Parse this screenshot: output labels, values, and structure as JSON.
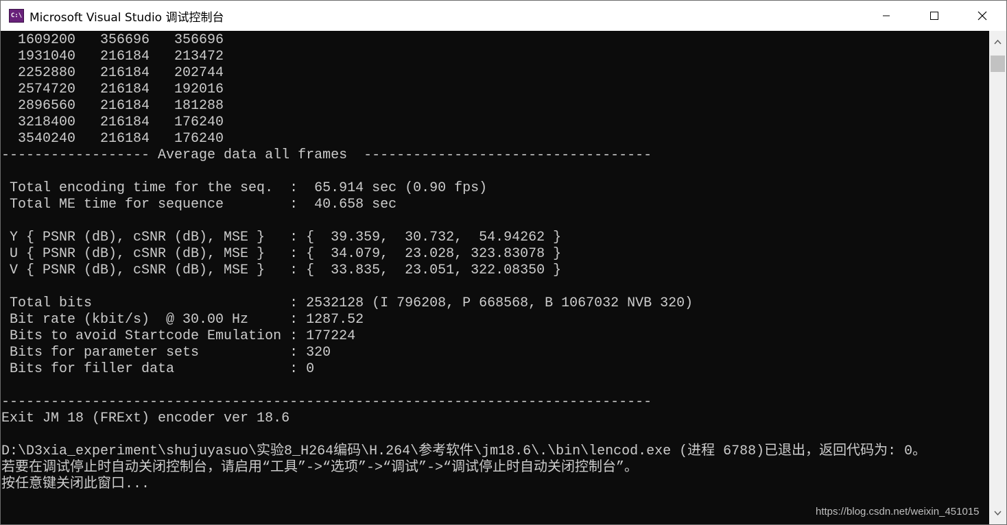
{
  "window": {
    "title": "Microsoft Visual Studio 调试控制台",
    "icon": "visual-studio-console-icon",
    "icon_text": "C:\\",
    "controls": {
      "minimize": "minimize-icon",
      "maximize": "maximize-icon",
      "close": "close-icon"
    }
  },
  "console": {
    "lines": [
      "  1609200   356696   356696",
      "  1931040   216184   213472",
      "  2252880   216184   202744",
      "  2574720   216184   192016",
      "  2896560   216184   181288",
      "  3218400   216184   176240",
      "  3540240   216184   176240",
      "------------------ Average data all frames  -----------------------------------",
      "",
      " Total encoding time for the seq.  :  65.914 sec (0.90 fps)",
      " Total ME time for sequence        :  40.658 sec",
      "",
      " Y { PSNR (dB), cSNR (dB), MSE }   : {  39.359,  30.732,  54.94262 }",
      " U { PSNR (dB), cSNR (dB), MSE }   : {  34.079,  23.028, 323.83078 }",
      " V { PSNR (dB), cSNR (dB), MSE }   : {  33.835,  23.051, 322.08350 }",
      "",
      " Total bits                        : 2532128 (I 796208, P 668568, B 1067032 NVB 320)",
      " Bit rate (kbit/s)  @ 30.00 Hz     : 1287.52",
      " Bits to avoid Startcode Emulation : 177224",
      " Bits for parameter sets           : 320",
      " Bits for filler data              : 0",
      "",
      "-------------------------------------------------------------------------------",
      "Exit JM 18 (FRExt) encoder ver 18.6",
      "",
      "D:\\D3xia_experiment\\shujuyasuo\\实验8_H264编码\\H.264\\参考软件\\jm18.6\\.\\bin\\lencod.exe (进程 6788)已退出，返回代码为: 0。",
      "若要在调试停止时自动关闭控制台，请启用“工具”->“选项”->“调试”->“调试停止时自动关闭控制台”。",
      "按任意键关闭此窗口..."
    ]
  },
  "watermark": "https://blog.csdn.net/weixin_451015",
  "colors": {
    "console_bg": "#0c0c0c",
    "console_text": "#cccccc",
    "titlebar_bg": "#ffffff",
    "scrollbar_bg": "#f0f0f0",
    "scroll_thumb": "#c2c2c2",
    "icon_bg": "#68217a"
  }
}
